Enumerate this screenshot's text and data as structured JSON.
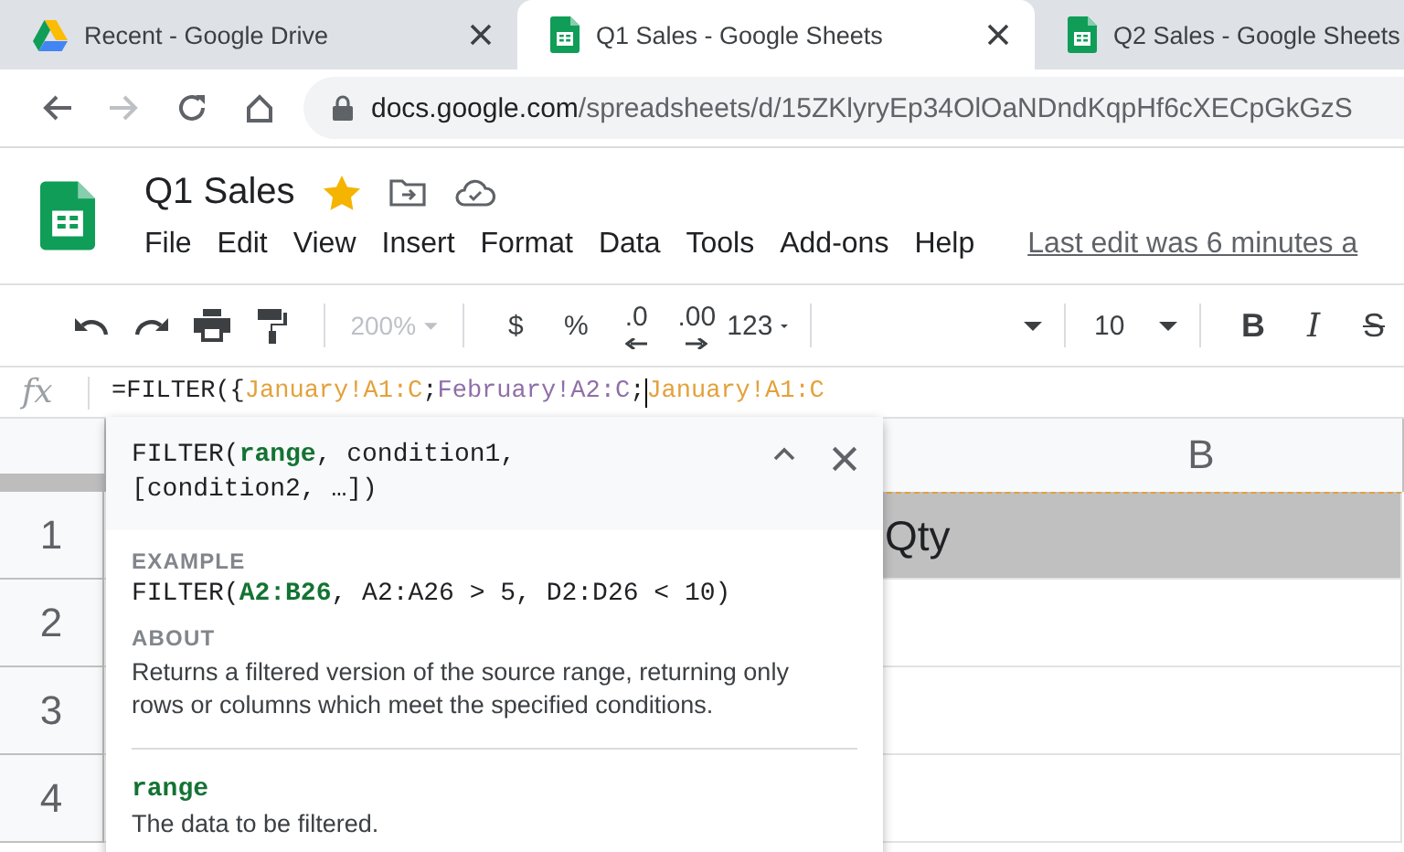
{
  "browser": {
    "tabs": [
      {
        "title": "Recent - Google Drive",
        "kind": "drive",
        "selected": false
      },
      {
        "title": "Q1 Sales - Google Sheets",
        "kind": "sheets",
        "selected": true
      },
      {
        "title": "Q2 Sales - Google Sheets",
        "kind": "sheets",
        "selected": false
      }
    ],
    "nav": [
      {
        "kind": "back",
        "disabled": false
      },
      {
        "kind": "forward",
        "disabled": true
      },
      {
        "kind": "reload",
        "disabled": false
      },
      {
        "kind": "home",
        "disabled": false
      }
    ],
    "url": {
      "host": "docs.google.com",
      "path": "/spreadsheets/d/15ZKlyryEp34OlOaNDndKqpHf6cXECpGkGzS"
    }
  },
  "document": {
    "title": "Q1 Sales",
    "starred": true,
    "menus": [
      "File",
      "Edit",
      "View",
      "Insert",
      "Format",
      "Data",
      "Tools",
      "Add-ons",
      "Help"
    ],
    "last_edit": "Last edit was 6 minutes a"
  },
  "toolbar": [
    {
      "kind": "undo"
    },
    {
      "kind": "redo"
    },
    {
      "kind": "print"
    },
    {
      "kind": "paint"
    },
    {
      "kind": "sep"
    },
    {
      "kind": "zoom",
      "text": "200%",
      "disabled": true
    },
    {
      "kind": "sep"
    },
    {
      "kind": "text",
      "text": "$"
    },
    {
      "kind": "text",
      "text": "%"
    },
    {
      "kind": "dec-less",
      "text": ".0"
    },
    {
      "kind": "dec-more",
      "text": ".00"
    },
    {
      "kind": "number-format",
      "text": "123"
    },
    {
      "kind": "sep"
    },
    {
      "kind": "font-menu"
    },
    {
      "kind": "sep"
    },
    {
      "kind": "font-size",
      "text": "10"
    },
    {
      "kind": "sep"
    },
    {
      "kind": "bold",
      "text": "B"
    },
    {
      "kind": "italic",
      "text": "I"
    },
    {
      "kind": "strike",
      "text": "S"
    }
  ],
  "formula_bar": {
    "label": "fx",
    "parts": [
      {
        "text": "=FILTER({",
        "color": "#202124",
        "cursor_before": false
      },
      {
        "text": "January!A1:C",
        "color": "#e3a13b",
        "cursor_before": false
      },
      {
        "text": ";",
        "color": "#202124",
        "cursor_before": false
      },
      {
        "text": "February!A2:C",
        "color": "#8f6fa8",
        "cursor_before": false
      },
      {
        "text": ";",
        "color": "#202124",
        "cursor_before": false
      },
      {
        "text": "January!A1:C",
        "color": "#e3a13b",
        "cursor_before": true
      }
    ]
  },
  "grid": {
    "columns": [
      {
        "label": "B"
      }
    ],
    "rows": [
      {
        "number": "1",
        "cell": "Qty",
        "highlighted": true
      },
      {
        "number": "2",
        "highlighted": false
      },
      {
        "number": "3",
        "highlighted": false
      },
      {
        "number": "4",
        "highlighted": false
      }
    ]
  },
  "help_popup": {
    "syntax": "FILTER(**range**, condition1, [condition2, …])",
    "example_label": "EXAMPLE",
    "example": "FILTER(**A2:B26**, A2:A26 > 5, D2:D26 < 10)",
    "about_label": "ABOUT",
    "about": "Returns a filtered version of the source range, returning only rows or columns which meet the specified conditions.",
    "argument": {
      "name": "range",
      "description": "The data to be filtered."
    }
  }
}
